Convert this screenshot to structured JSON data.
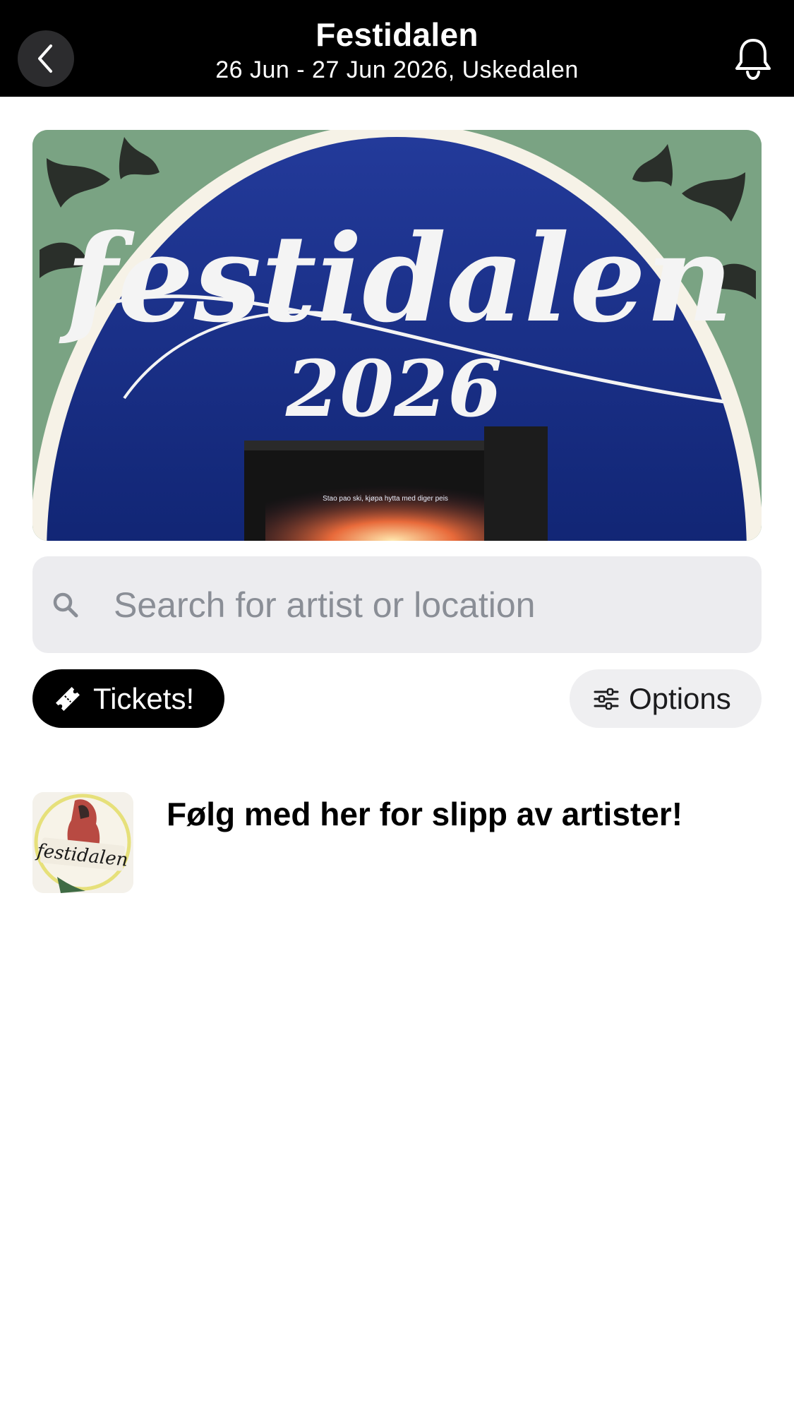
{
  "header": {
    "title": "Festidalen",
    "subtitle": "26 Jun - 27 Jun 2026, Uskedalen"
  },
  "banner": {
    "logo_text": "festidalen",
    "year": "2026",
    "stage_text": "Stao pao ski, kjøpa hytta med diger peis"
  },
  "search": {
    "placeholder": "Search for artist or location",
    "value": ""
  },
  "actions": {
    "tickets_label": "Tickets!",
    "options_label": "Options"
  },
  "news": [
    {
      "thumb_text": "festidalen",
      "text": "Følg med her for slipp av artister!"
    }
  ],
  "colors": {
    "header_bg": "#000000",
    "search_bg": "#ececef",
    "tickets_bg": "#000000",
    "options_bg": "#efeff1"
  }
}
